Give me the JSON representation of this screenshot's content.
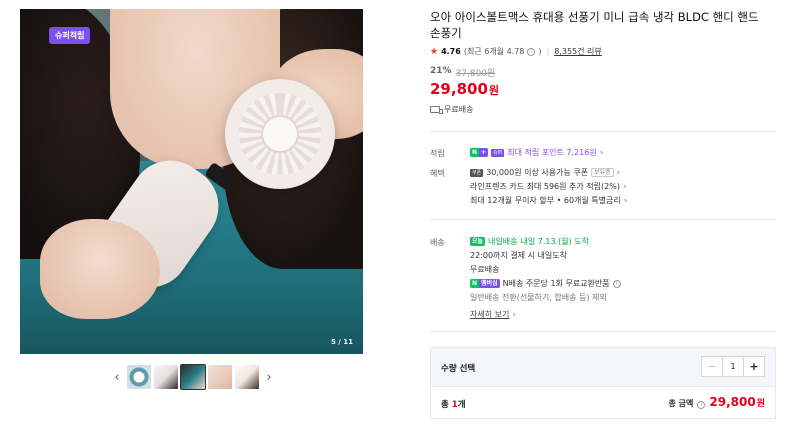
{
  "gallery": {
    "badge": "슈퍼적립",
    "counter": "5 / 11",
    "prev_icon": "chevron-left-icon",
    "next_icon": "chevron-right-icon",
    "thumbnail_count": 5,
    "active_thumbnail": 3
  },
  "product": {
    "title": "오아 아이스볼트맥스 휴대용 선풍기 미니 급속 냉각 BLDC 핸디 핸드 손풍기",
    "rating": {
      "score": "4.76",
      "recent": "(최근 6개월 4.78",
      "recent_suffix": ")",
      "reviews": "8,355건 리뷰"
    },
    "discount_pct": "21%",
    "original_price": "37,800원",
    "price": "29,800",
    "price_unit": "원",
    "free_shipping": "무료배송"
  },
  "benefits": {
    "point_label": "적립",
    "point_badge_n": "N",
    "point_badge_plus": "+",
    "point_badge_text": "슈퍼",
    "point_text": "최대 적립 포인트 7,216원",
    "benefit_label": "혜택",
    "coupon_tag": "쿠폰",
    "coupon_text": "30,000원 이상 사용가능 쿠폰",
    "coupon_badge": "보유중",
    "card_text": "라인프렌즈 카드 최대 596원 추가 적립(2%)",
    "installment_text": "최대 12개월 무이자 할부 • 60개월 특별금리"
  },
  "delivery": {
    "label": "배송",
    "today_tag": "오늘",
    "today_label": "내일배송",
    "arrival": "내일 7.13.(월) 도착",
    "cutoff": "22:00까지 결제 시 내일도착",
    "free": "무료배송",
    "return_tag_n": "N",
    "return_tag_text": "멤버십",
    "return_text": "N배송 주문당 1회 무료교환반품",
    "return_note": "일반배송 전환(선물하기, 합배송 등) 제외",
    "more": "자세히 보기"
  },
  "order": {
    "qty_label": "수량 선택",
    "qty_value": "1",
    "minus": "−",
    "plus": "+",
    "total_count_prefix": "총 ",
    "total_count_num": "1",
    "total_count_suffix": "개",
    "total_label": "총 금액",
    "total_amount": "29,800",
    "total_unit": "원"
  }
}
